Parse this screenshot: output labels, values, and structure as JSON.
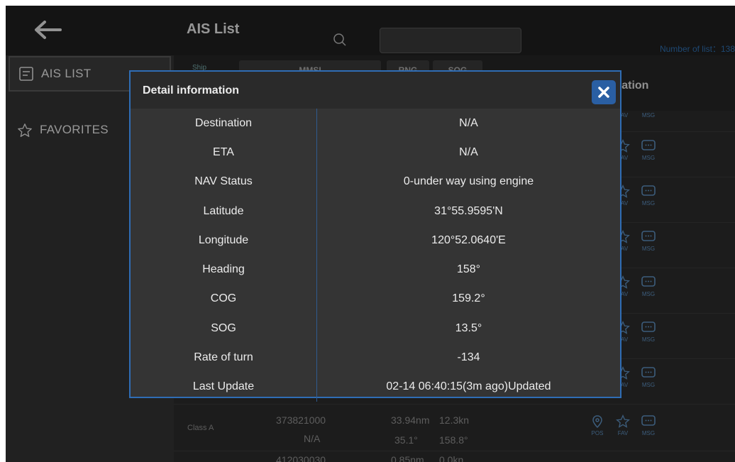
{
  "sidebar": {
    "items": [
      {
        "label": "AIS LIST",
        "icon": "list-icon"
      },
      {
        "label": "FAVORITES",
        "icon": "star-icon"
      }
    ]
  },
  "header": {
    "title": "AIS List",
    "search_placeholder": "",
    "count_label": "Number of list：138"
  },
  "table_header": {
    "ship_label": "Ship",
    "tabs": [
      "MMSI",
      "RNG",
      "SOG"
    ],
    "operation_label": "ration"
  },
  "row_ops": {
    "pos": "POS",
    "fav": "FAV",
    "msg": "MSG"
  },
  "visible_row": {
    "class": "Class A",
    "mmsi": "373821000",
    "name": "N/A",
    "range": "33.94nm",
    "sog": "12.3kn",
    "brg": "35.1°",
    "cog": "158.8°"
  },
  "partial_row": {
    "mmsi": "412030030",
    "range": "0.85nm",
    "sog": "0.0kn"
  },
  "dialog": {
    "title": "Detail information",
    "rows": [
      {
        "key": "Destination",
        "value": "N/A"
      },
      {
        "key": "ETA",
        "value": "N/A"
      },
      {
        "key": "NAV Status",
        "value": "0-under way using engine"
      },
      {
        "key": "Latitude",
        "value": "31°55.9595'N"
      },
      {
        "key": "Longitude",
        "value": "120°52.0640'E"
      },
      {
        "key": "Heading",
        "value": "158°"
      },
      {
        "key": "COG",
        "value": "159.2°"
      },
      {
        "key": "SOG",
        "value": "13.5°"
      },
      {
        "key": "Rate of turn",
        "value": "-134"
      },
      {
        "key": "Last Update",
        "value": "02-14 06:40:15(3m ago)Updated"
      }
    ]
  },
  "colors": {
    "accent": "#2f6db5",
    "background": "#2f2f2f",
    "text": "#ececec"
  }
}
